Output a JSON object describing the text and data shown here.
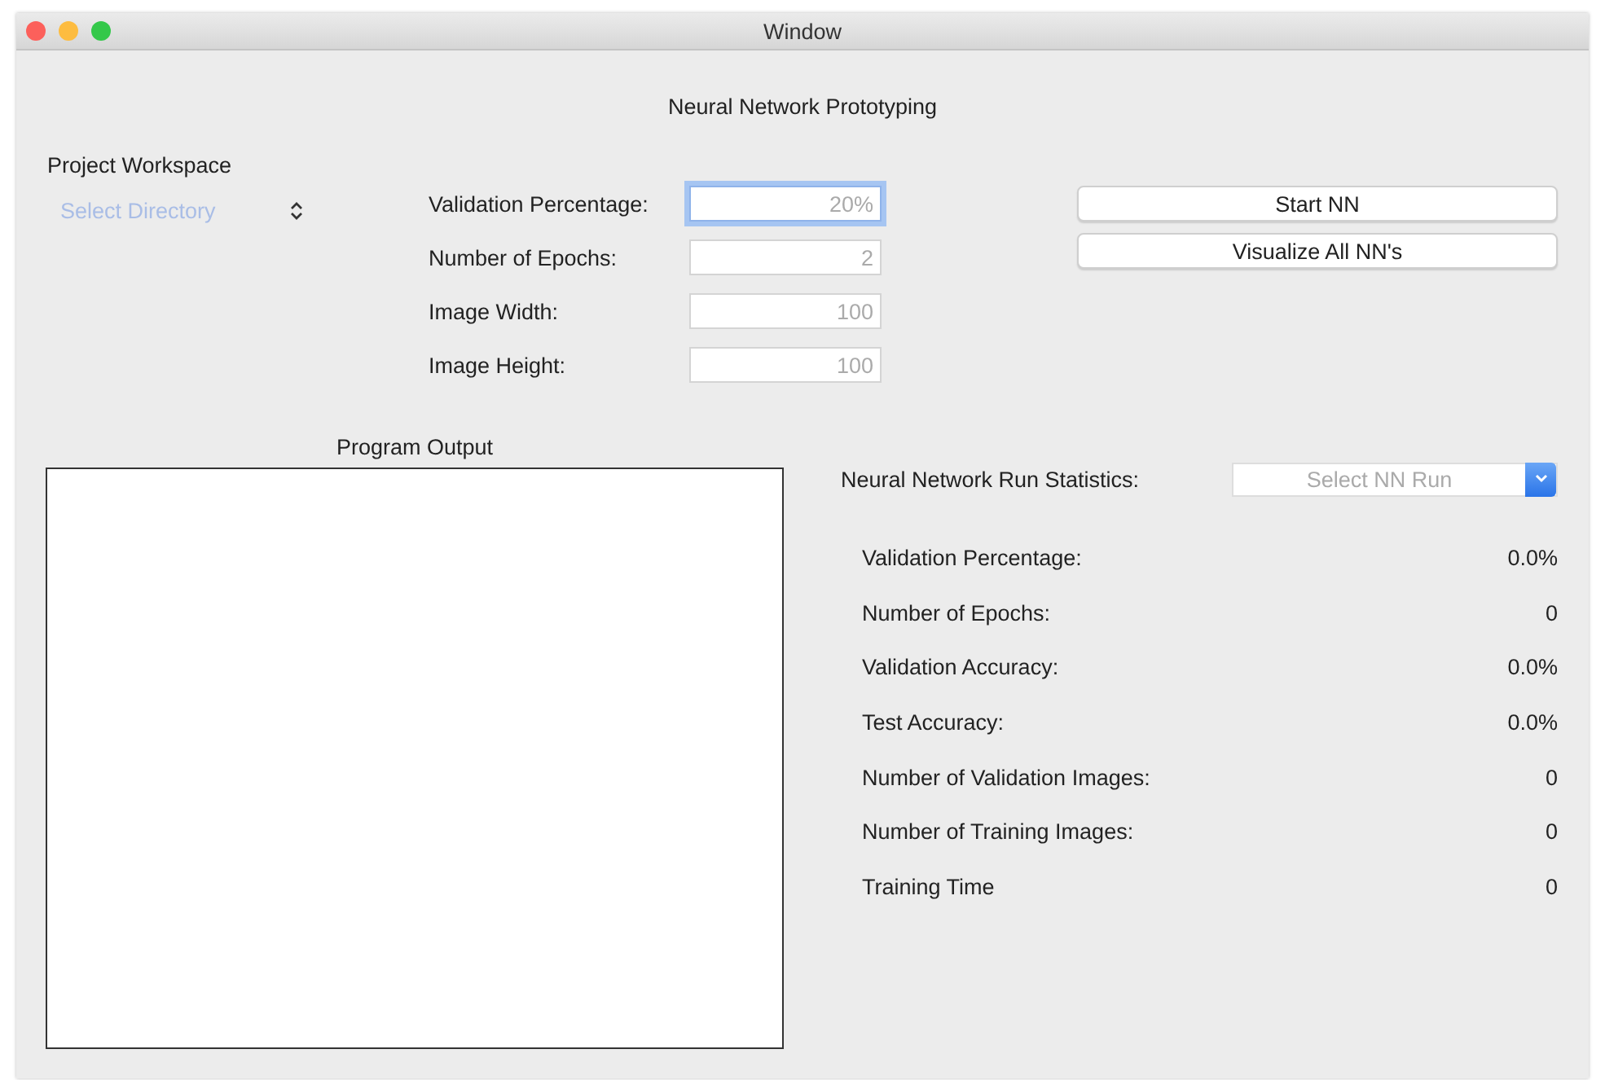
{
  "window": {
    "title": "Window"
  },
  "heading": "Neural Network Prototyping",
  "workspace": {
    "label": "Project Workspace",
    "directory_placeholder": "Select Directory"
  },
  "fields": [
    {
      "label": "Validation Percentage:",
      "placeholder": "20%",
      "focused": true
    },
    {
      "label": "Number of Epochs:",
      "placeholder": "2",
      "focused": false
    },
    {
      "label": "Image Width:",
      "placeholder": "100",
      "focused": false
    },
    {
      "label": "Image Height:",
      "placeholder": "100",
      "focused": false
    }
  ],
  "buttons": [
    "Start NN",
    "Visualize All NN's"
  ],
  "output": {
    "label": "Program Output"
  },
  "statistics": {
    "label": "Neural Network Run Statistics:",
    "run_placeholder": "Select NN Run",
    "rows": [
      {
        "label": "Validation Percentage:",
        "value": "0.0%"
      },
      {
        "label": "Number of Epochs:",
        "value": "0"
      },
      {
        "label": "Validation Accuracy:",
        "value": "0.0%"
      },
      {
        "label": "Test Accuracy:",
        "value": "0.0%"
      },
      {
        "label": "Number of Validation Images:",
        "value": "0"
      },
      {
        "label": "Number of Training Images:",
        "value": "0"
      },
      {
        "label": "Training Time",
        "value": "0"
      }
    ]
  }
}
